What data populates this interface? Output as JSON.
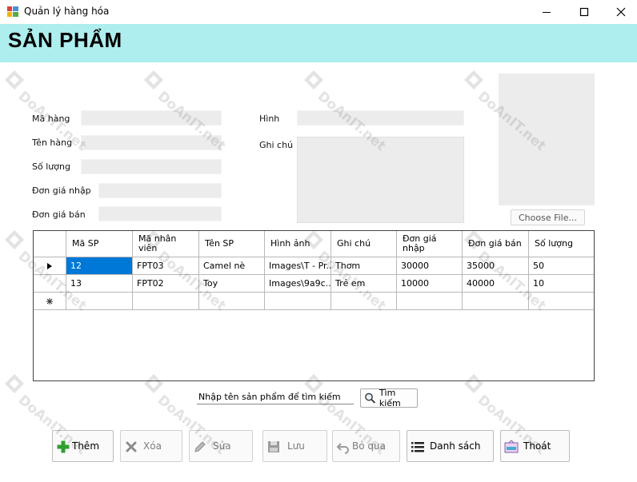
{
  "window": {
    "title": "Quản lý hàng hóa"
  },
  "header": {
    "title": "SẢN PHẨM"
  },
  "form": {
    "ma_hang_label": "Mã hàng",
    "ten_hang_label": "Tên hàng",
    "so_luong_label": "Số lượng",
    "don_gia_nhap_label": "Đơn giá nhập",
    "don_gia_ban_label": "Đơn giá bán",
    "hinh_label": "Hình",
    "ghi_chu_label": "Ghi chú",
    "choose_file_label": "Choose File..."
  },
  "grid": {
    "columns": [
      "Mã SP",
      "Mã nhân viên",
      "Tên SP",
      "Hình ảnh",
      "Ghi chú",
      "Đơn giá nhập",
      "Đơn giá bán",
      "Số lượng"
    ],
    "rows": [
      [
        "12",
        "FPT03",
        "Camel nè",
        "Images\\T - Pr...",
        "Thơm",
        "30000",
        "35000",
        "50"
      ],
      [
        "13",
        "FPT02",
        "Toy",
        "Images\\9a9c...",
        "Trẻ em",
        "10000",
        "40000",
        "10"
      ]
    ]
  },
  "search": {
    "value": "Nhập tên sản phẩm để tìm kiếm",
    "button_label": "Tìm kiếm"
  },
  "actions": {
    "add": "Thêm",
    "delete": "Xóa",
    "edit": "Sửa",
    "save": "Lưu",
    "skip": "Bỏ qua",
    "list": "Danh sách",
    "exit": "Thoát"
  },
  "watermark": {
    "text": "DoAnIT.net"
  },
  "colors": {
    "header_bg": "#aeeeee",
    "field_bg": "#ececec",
    "selection": "#0078d7",
    "add_icon": "#2e9e2e"
  },
  "icons": {
    "app": "app-icon",
    "minimize": "minimize-icon",
    "maximize": "maximize-icon",
    "close": "close-icon",
    "search": "magnifier-icon",
    "add": "plus-icon",
    "delete": "x-icon",
    "edit": "pencil-icon",
    "save": "floppy-icon",
    "skip": "undo-icon",
    "list": "list-icon",
    "exit": "exit-icon"
  }
}
